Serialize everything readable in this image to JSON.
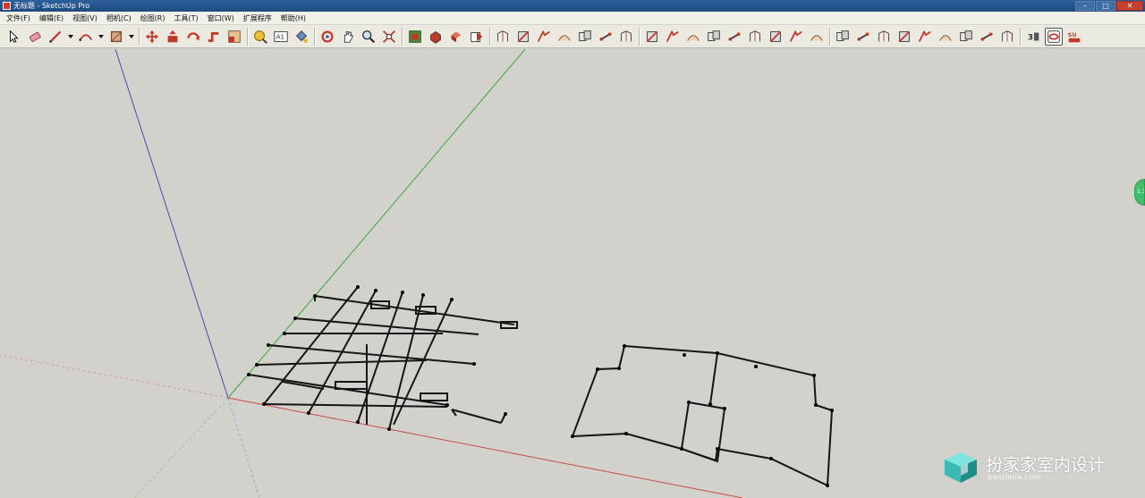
{
  "window": {
    "title": "无标题 - SketchUp Pro",
    "buttons": [
      "–",
      "□",
      "✕"
    ]
  },
  "menu": {
    "items": [
      "文件(F)",
      "编辑(E)",
      "视图(V)",
      "相机(C)",
      "绘图(R)",
      "工具(T)",
      "窗口(W)",
      "扩展程序",
      "帮助(H)"
    ]
  },
  "toolbar": {
    "tools": [
      "select-tool",
      "eraser-tool",
      "line-tool",
      "line-tool-dropdown",
      "arc-tool",
      "arc-tool-dropdown",
      "rectangle-tool",
      "rectangle-tool-dropdown",
      "sep",
      "move-tool",
      "push-pull-tool",
      "rotate-tool",
      "follow-me-tool",
      "scale-tool",
      "sep",
      "tape-measure-tool",
      "text-tool",
      "paint-bucket-tool",
      "sep",
      "orbit-tool",
      "pan-tool",
      "zoom-tool",
      "zoom-extents-tool",
      "sep",
      "3d-warehouse-button",
      "extension-warehouse-button",
      "layout-button",
      "send-to-layout-button",
      "sep",
      "sandbox-from-contours",
      "sandbox-from-scratch",
      "smoove-tool",
      "stamp-tool",
      "drape-tool",
      "add-detail-tool",
      "flip-edge-tool",
      "sep",
      "roof-tool",
      "round-corner-tool",
      "fillet-tool",
      "chamfer-tool",
      "offset-edges-tool",
      "bezier-tool",
      "curve-tool",
      "weld-tool",
      "subdivide-tool",
      "sep",
      "solid-tools-1",
      "solid-tools-2",
      "solid-tools-3",
      "solid-tools-4",
      "solid-tools-5",
      "solid-tools-6",
      "solid-tools-7",
      "solid-tools-8",
      "solid-tools-9",
      "sep",
      "plugin-1",
      "ruby-console-button",
      "sketchucation-button"
    ],
    "active_tool": "ruby-console-button"
  },
  "viewport": {
    "axis_colors": {
      "red": "#c84a4a",
      "green": "#3aa83a",
      "blue": "#4a4ab4"
    },
    "background": "#d2d1cc",
    "side_handle_label": "1.3"
  },
  "watermark": {
    "brand": "扮家家室内设计",
    "url": "banjiajia.com"
  }
}
